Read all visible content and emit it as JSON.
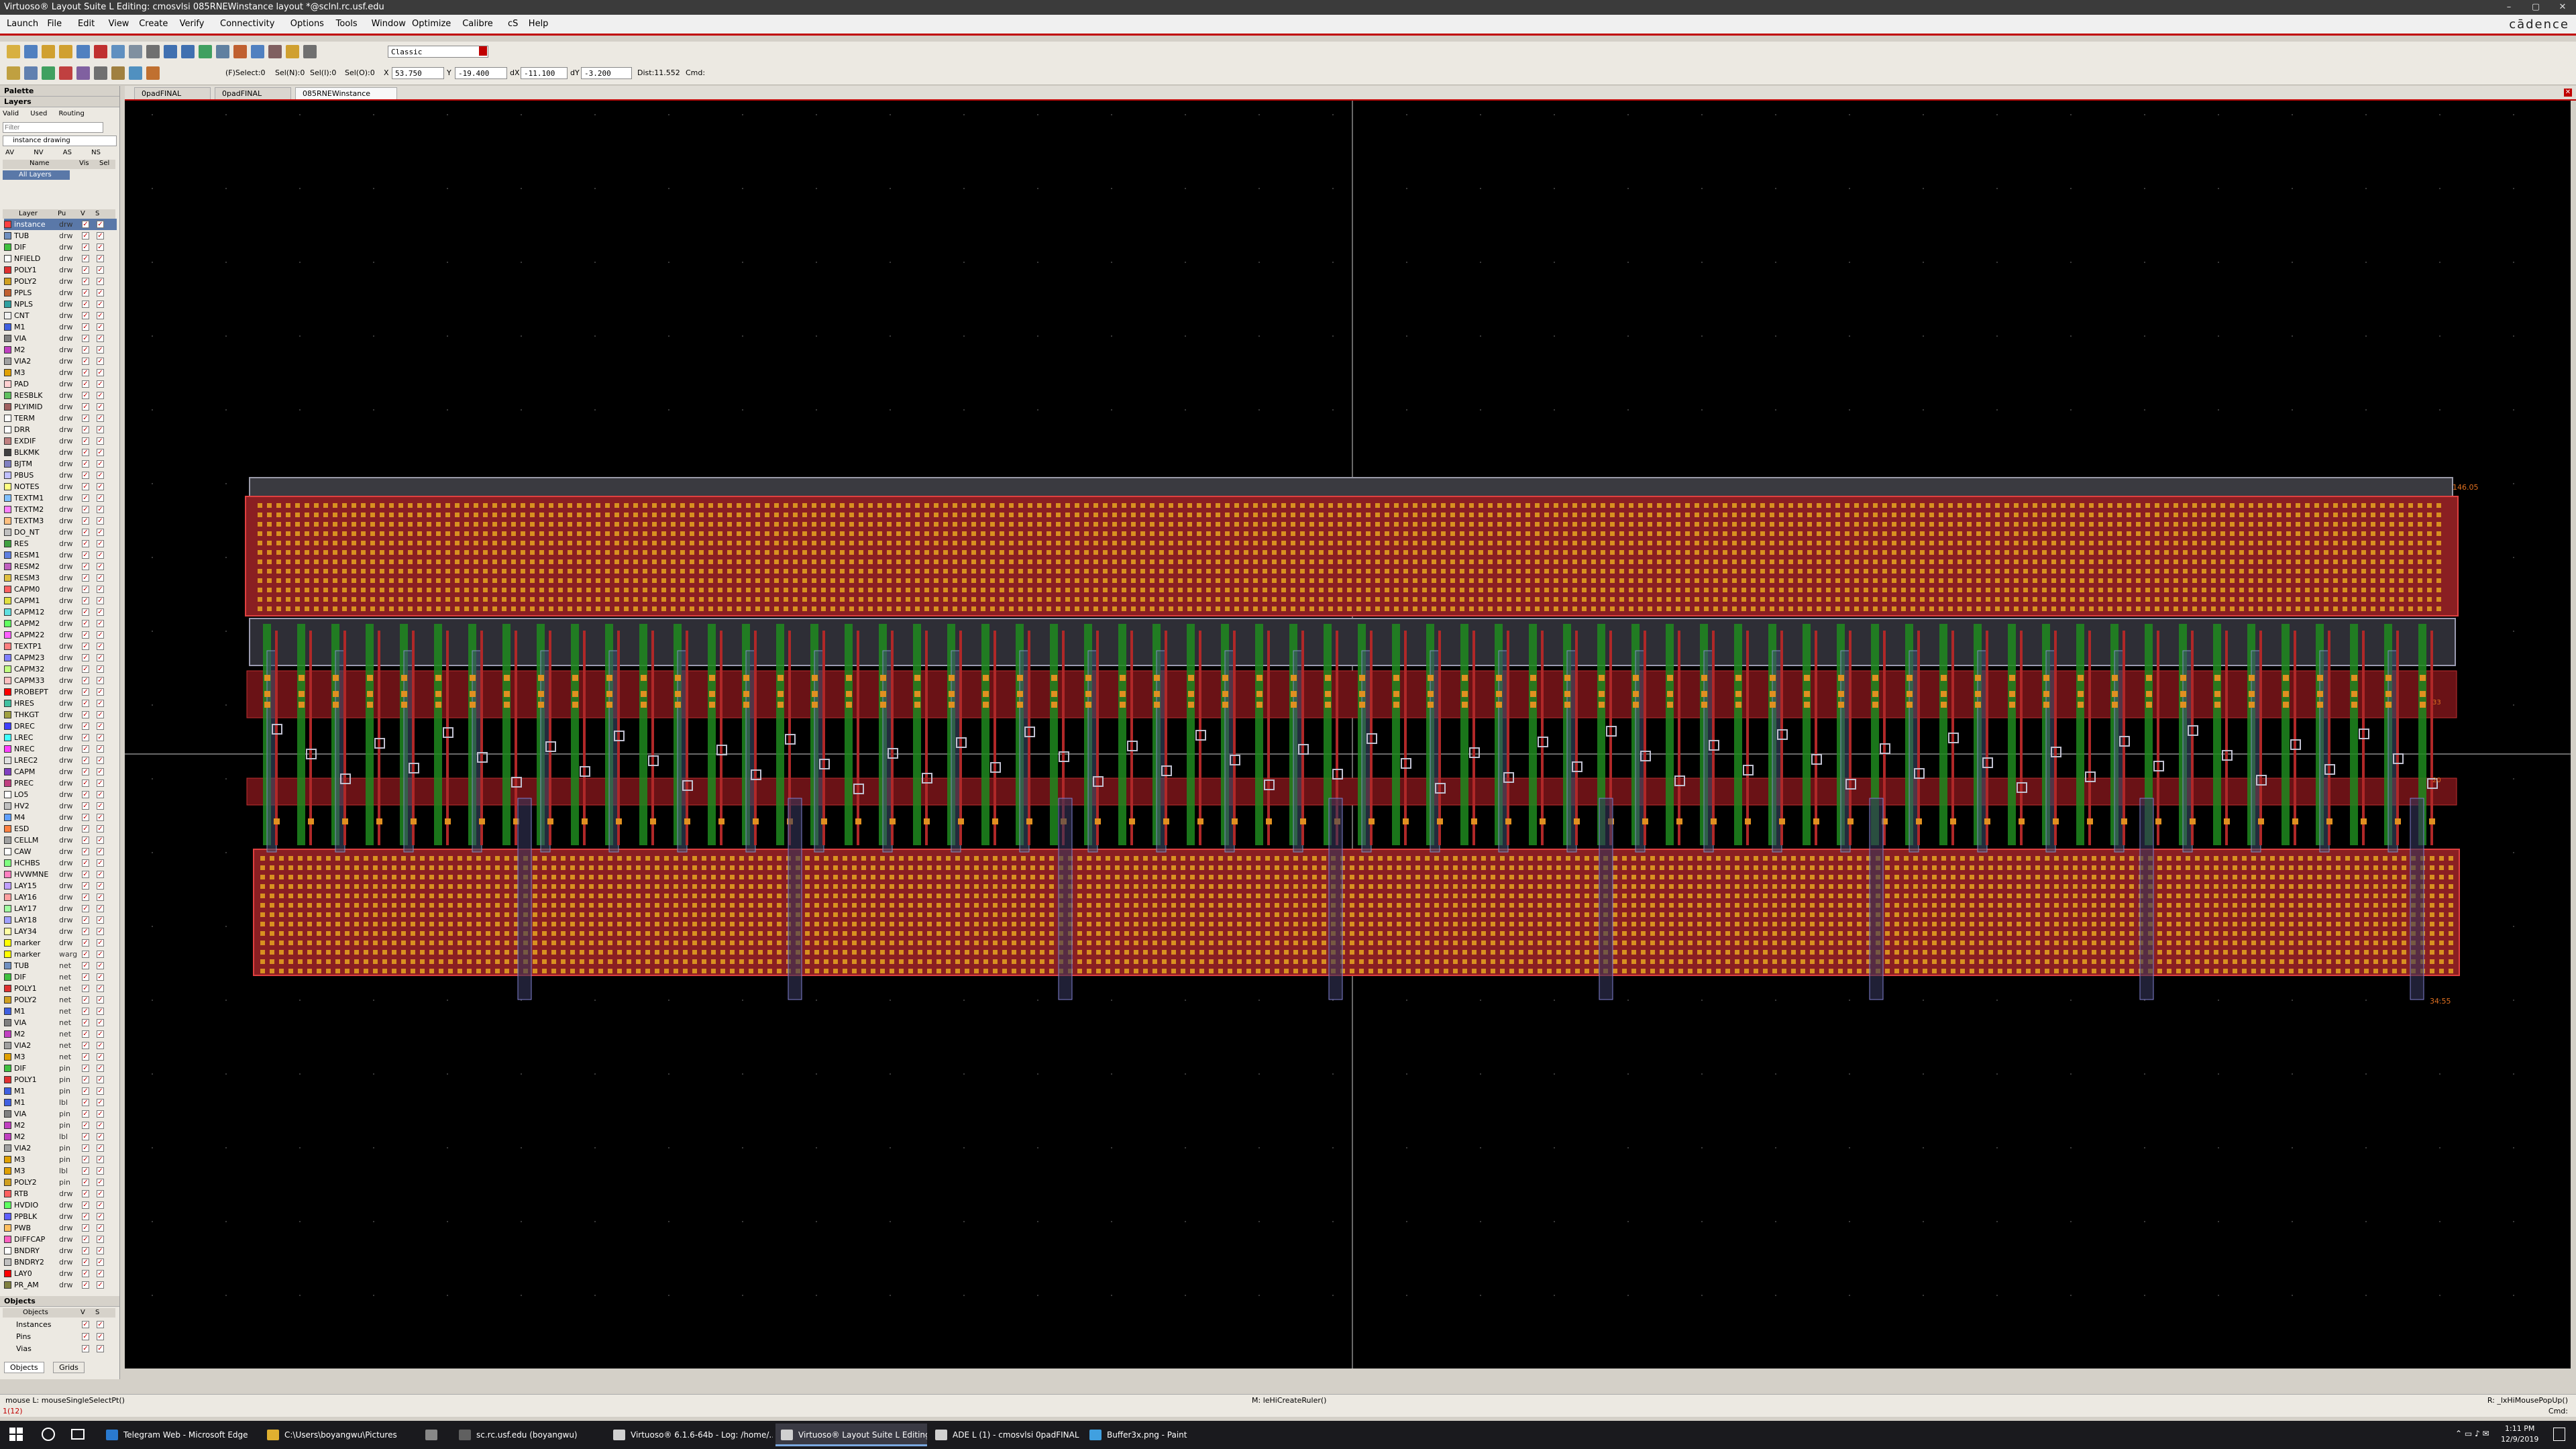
{
  "window": {
    "title": "Virtuoso® Layout Suite L Editing: cmosvlsi 085RNEWinstance layout *@sclnl.rc.usf.edu",
    "brand": "cādence"
  },
  "menu": [
    "Launch",
    "File",
    "Edit",
    "View",
    "Create",
    "Verify",
    "Connectivity",
    "Options",
    "Tools",
    "Window",
    "Optimize",
    "Calibre",
    "cS",
    "Help"
  ],
  "toolbar": {
    "mode_select": "Classic",
    "select_label": "(F)Select:0",
    "sel_n": "Sel(N):0",
    "sel_i": "Sel(I):0",
    "sel_o": "Sel(O):0",
    "x_label": "X",
    "x_value": "53.750",
    "y_label": "Y",
    "y_value": "-19.400",
    "dx_label": "dX",
    "dx_value": "-11.100",
    "dy_label": "dY",
    "dy_value": "-3.200",
    "dist": "Dist:11.552",
    "cmd": "Cmd:"
  },
  "tabs": [
    "0padFINAL",
    "0padFINAL",
    "085RNEWinstance"
  ],
  "palette": {
    "title": "Palette",
    "layers_header": "Layers",
    "filters": [
      "Valid",
      "Used",
      "Routing"
    ],
    "filter_placeholder": "Filter",
    "current_layer": "instance drawing",
    "vis_buttons": [
      "AV",
      "NV",
      "AS",
      "NS"
    ],
    "columns": [
      "Name",
      "Vis",
      "Sel"
    ],
    "all_layers": "All Layers",
    "layer_columns": [
      "Layer",
      "Pu",
      "V",
      "S"
    ],
    "layers": [
      {
        "n": "instance",
        "p": "drw",
        "c": "#ff4040"
      },
      {
        "n": "TUB",
        "p": "drw",
        "c": "#7090c0"
      },
      {
        "n": "DIF",
        "p": "drw",
        "c": "#40c040"
      },
      {
        "n": "NFIELD",
        "p": "drw",
        "c": "#ffffff"
      },
      {
        "n": "POLY1",
        "p": "drw",
        "c": "#e03030"
      },
      {
        "n": "POLY2",
        "p": "drw",
        "c": "#d0a020"
      },
      {
        "n": "PPLS",
        "p": "drw",
        "c": "#c06030"
      },
      {
        "n": "NPLS",
        "p": "drw",
        "c": "#30a0a0"
      },
      {
        "n": "CNT",
        "p": "drw",
        "c": "#f0f0f0"
      },
      {
        "n": "M1",
        "p": "drw",
        "c": "#4060e0"
      },
      {
        "n": "VIA",
        "p": "drw",
        "c": "#808080"
      },
      {
        "n": "M2",
        "p": "drw",
        "c": "#c040c0"
      },
      {
        "n": "VIA2",
        "p": "drw",
        "c": "#a0a0a0"
      },
      {
        "n": "M3",
        "p": "drw",
        "c": "#e0a000"
      },
      {
        "n": "PAD",
        "p": "drw",
        "c": "#ffd0d0"
      },
      {
        "n": "RESBLK",
        "p": "drw",
        "c": "#60c060"
      },
      {
        "n": "PLYIMID",
        "p": "drw",
        "c": "#a06060"
      },
      {
        "n": "TERM",
        "p": "drw",
        "c": "#ffffff"
      },
      {
        "n": "DRR",
        "p": "drw",
        "c": "#ffffff"
      },
      {
        "n": "EXDIF",
        "p": "drw",
        "c": "#c08080"
      },
      {
        "n": "BLKMK",
        "p": "drw",
        "c": "#404040"
      },
      {
        "n": "BJTM",
        "p": "drw",
        "c": "#8080c0"
      },
      {
        "n": "PBUS",
        "p": "drw",
        "c": "#c0c0ff"
      },
      {
        "n": "NOTES",
        "p": "drw",
        "c": "#ffff80"
      },
      {
        "n": "TEXTM1",
        "p": "drw",
        "c": "#80c0ff"
      },
      {
        "n": "TEXTM2",
        "p": "drw",
        "c": "#ff80ff"
      },
      {
        "n": "TEXTM3",
        "p": "drw",
        "c": "#ffc080"
      },
      {
        "n": "DO_NT",
        "p": "drw",
        "c": "#c0c0c0"
      },
      {
        "n": "RES",
        "p": "drw",
        "c": "#40a040"
      },
      {
        "n": "RESM1",
        "p": "drw",
        "c": "#6080e0"
      },
      {
        "n": "RESM2",
        "p": "drw",
        "c": "#c060c0"
      },
      {
        "n": "RESM3",
        "p": "drw",
        "c": "#e0c040"
      },
      {
        "n": "CAPM0",
        "p": "drw",
        "c": "#ff6060"
      },
      {
        "n": "CAPM1",
        "p": "drw",
        "c": "#e0e040"
      },
      {
        "n": "CAPM12",
        "p": "drw",
        "c": "#60e0e0"
      },
      {
        "n": "CAPM2",
        "p": "drw",
        "c": "#60ff60"
      },
      {
        "n": "CAPM22",
        "p": "drw",
        "c": "#ff60ff"
      },
      {
        "n": "TEXTP1",
        "p": "drw",
        "c": "#ff8080"
      },
      {
        "n": "CAPM23",
        "p": "drw",
        "c": "#8080ff"
      },
      {
        "n": "CAPM32",
        "p": "drw",
        "c": "#c0ff80"
      },
      {
        "n": "CAPM33",
        "p": "drw",
        "c": "#ffc0c0"
      },
      {
        "n": "PROBEPT",
        "p": "drw",
        "c": "#ff0000"
      },
      {
        "n": "HRES",
        "p": "drw",
        "c": "#40c0a0"
      },
      {
        "n": "THKGT",
        "p": "drw",
        "c": "#a0a040"
      },
      {
        "n": "DREC",
        "p": "drw",
        "c": "#4040ff"
      },
      {
        "n": "LREC",
        "p": "drw",
        "c": "#40ffff"
      },
      {
        "n": "NREC",
        "p": "drw",
        "c": "#ff40ff"
      },
      {
        "n": "LREC2",
        "p": "drw",
        "c": "#e0e0e0"
      },
      {
        "n": "CAPM",
        "p": "drw",
        "c": "#8040c0"
      },
      {
        "n": "PREC",
        "p": "drw",
        "c": "#c04080"
      },
      {
        "n": "LO5",
        "p": "drw",
        "c": "#ffffff"
      },
      {
        "n": "HV2",
        "p": "drw",
        "c": "#c0c0c0"
      },
      {
        "n": "M4",
        "p": "drw",
        "c": "#60a0ff"
      },
      {
        "n": "ESD",
        "p": "drw",
        "c": "#ff8040"
      },
      {
        "n": "CELLM",
        "p": "drw",
        "c": "#a0a0a0"
      },
      {
        "n": "CAW",
        "p": "drw",
        "c": "#ffffff"
      },
      {
        "n": "HCHBS",
        "p": "drw",
        "c": "#80ff80"
      },
      {
        "n": "HVWMNE",
        "p": "drw",
        "c": "#ff80c0"
      },
      {
        "n": "LAY15",
        "p": "drw",
        "c": "#c0a0ff"
      },
      {
        "n": "LAY16",
        "p": "drw",
        "c": "#ffa0a0"
      },
      {
        "n": "LAY17",
        "p": "drw",
        "c": "#a0ffa0"
      },
      {
        "n": "LAY18",
        "p": "drw",
        "c": "#a0a0ff"
      },
      {
        "n": "LAY34",
        "p": "drw",
        "c": "#ffffa0"
      },
      {
        "n": "marker",
        "p": "drw",
        "c": "#ffff00"
      },
      {
        "n": "marker",
        "p": "warg",
        "c": "#ffff00"
      },
      {
        "n": "TUB",
        "p": "net",
        "c": "#7090c0"
      },
      {
        "n": "DIF",
        "p": "net",
        "c": "#40c040"
      },
      {
        "n": "POLY1",
        "p": "net",
        "c": "#e03030"
      },
      {
        "n": "POLY2",
        "p": "net",
        "c": "#d0a020"
      },
      {
        "n": "M1",
        "p": "net",
        "c": "#4060e0"
      },
      {
        "n": "VIA",
        "p": "net",
        "c": "#808080"
      },
      {
        "n": "M2",
        "p": "net",
        "c": "#c040c0"
      },
      {
        "n": "VIA2",
        "p": "net",
        "c": "#a0a0a0"
      },
      {
        "n": "M3",
        "p": "net",
        "c": "#e0a000"
      },
      {
        "n": "DIF",
        "p": "pin",
        "c": "#40c040"
      },
      {
        "n": "POLY1",
        "p": "pin",
        "c": "#e03030"
      },
      {
        "n": "M1",
        "p": "pin",
        "c": "#4060e0"
      },
      {
        "n": "M1",
        "p": "lbl",
        "c": "#4060e0"
      },
      {
        "n": "VIA",
        "p": "pin",
        "c": "#808080"
      },
      {
        "n": "M2",
        "p": "pin",
        "c": "#c040c0"
      },
      {
        "n": "M2",
        "p": "lbl",
        "c": "#c040c0"
      },
      {
        "n": "VIA2",
        "p": "pin",
        "c": "#a0a0a0"
      },
      {
        "n": "M3",
        "p": "pin",
        "c": "#e0a000"
      },
      {
        "n": "M3",
        "p": "lbl",
        "c": "#e0a000"
      },
      {
        "n": "POLY2",
        "p": "pin",
        "c": "#d0a020"
      },
      {
        "n": "RTB",
        "p": "drw",
        "c": "#ff6060"
      },
      {
        "n": "HVDIO",
        "p": "drw",
        "c": "#60ff60"
      },
      {
        "n": "PPBLK",
        "p": "drw",
        "c": "#6060ff"
      },
      {
        "n": "PWB",
        "p": "drw",
        "c": "#ffc060"
      },
      {
        "n": "DIFFCAP",
        "p": "drw",
        "c": "#ff60c0"
      },
      {
        "n": "BNDRY",
        "p": "drw",
        "c": "#ffffff"
      },
      {
        "n": "BNDRY2",
        "p": "drw",
        "c": "#c0c0c0"
      },
      {
        "n": "LAY0",
        "p": "drw",
        "c": "#ff0000"
      },
      {
        "n": "PR_AM",
        "p": "drw",
        "c": "#808040"
      }
    ],
    "objects_header": "Objects",
    "objects_columns": [
      "Objects",
      "V",
      "S"
    ],
    "objects": [
      "Instances",
      "Pins",
      "Vias"
    ],
    "bottom_tabs": [
      "Objects",
      "Grids"
    ]
  },
  "canvas_labels": {
    "top_coord": "146.05",
    "bottom_coord": "34.55",
    "right_mid_1": "33",
    "right_mid_2": "20"
  },
  "status": {
    "left": "mouse L: mouseSingleSelectPt()",
    "middle": "M: leHiCreateRuler()",
    "right": "R: _lxHiMousePopUp()",
    "line2_left": "1(12)",
    "line2_right": "Cmd:"
  },
  "taskbar": {
    "items": [
      {
        "label": "Telegram Web - Microsoft Edge",
        "c": "#2a7ad0"
      },
      {
        "label": "C:\\Users\\boyangwu\\Pictures",
        "c": "#e0b030"
      },
      {
        "label": "",
        "c": "#888888"
      },
      {
        "label": "sc.rc.usf.edu (boyangwu)",
        "c": "#606060"
      },
      {
        "label": "Virtuoso® 6.1.6-64b - Log: /home/...",
        "c": "#d0d0d0"
      },
      {
        "label": "Virtuoso® Layout Suite L Editing: c...",
        "c": "#d0d0d0"
      },
      {
        "label": "ADE L (1) - cmosvlsi 0padFINAL c...",
        "c": "#d0d0d0"
      },
      {
        "label": "Buffer3x.png - Paint",
        "c": "#40a0e0"
      }
    ],
    "time": "1:11 PM",
    "date": "12/9/2019"
  }
}
